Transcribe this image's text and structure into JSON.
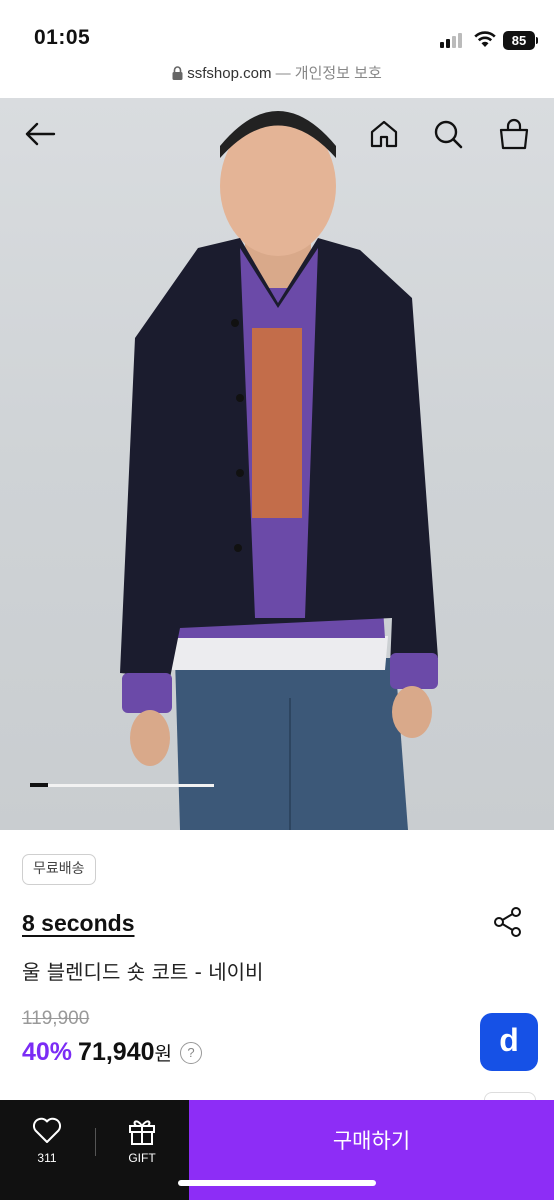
{
  "status_bar": {
    "time": "01:05",
    "battery": "85"
  },
  "url_bar": {
    "domain": "ssfshop.com",
    "suffix": "— 개인정보 보호"
  },
  "hero": {
    "icons": {
      "back": "arrow-left-icon",
      "home": "home-icon",
      "search": "search-icon",
      "cart": "shopping-bag-icon"
    },
    "image_progress": 0.1
  },
  "product": {
    "badge": "무료배송",
    "brand": "8 seconds",
    "name": "울 블렌디드 숏 코트 - 네이비",
    "original_price": "119,900",
    "discount": "40%",
    "price": "71,940",
    "currency": "원",
    "help": "?"
  },
  "floating_app": {
    "label": "d",
    "color": "#1651e6"
  },
  "bottom_bar": {
    "like_count": "311",
    "gift_label": "GIFT",
    "buy_label": "구매하기",
    "buy_color": "#8d2df6"
  },
  "colors": {
    "accent": "#7b2cf5"
  }
}
